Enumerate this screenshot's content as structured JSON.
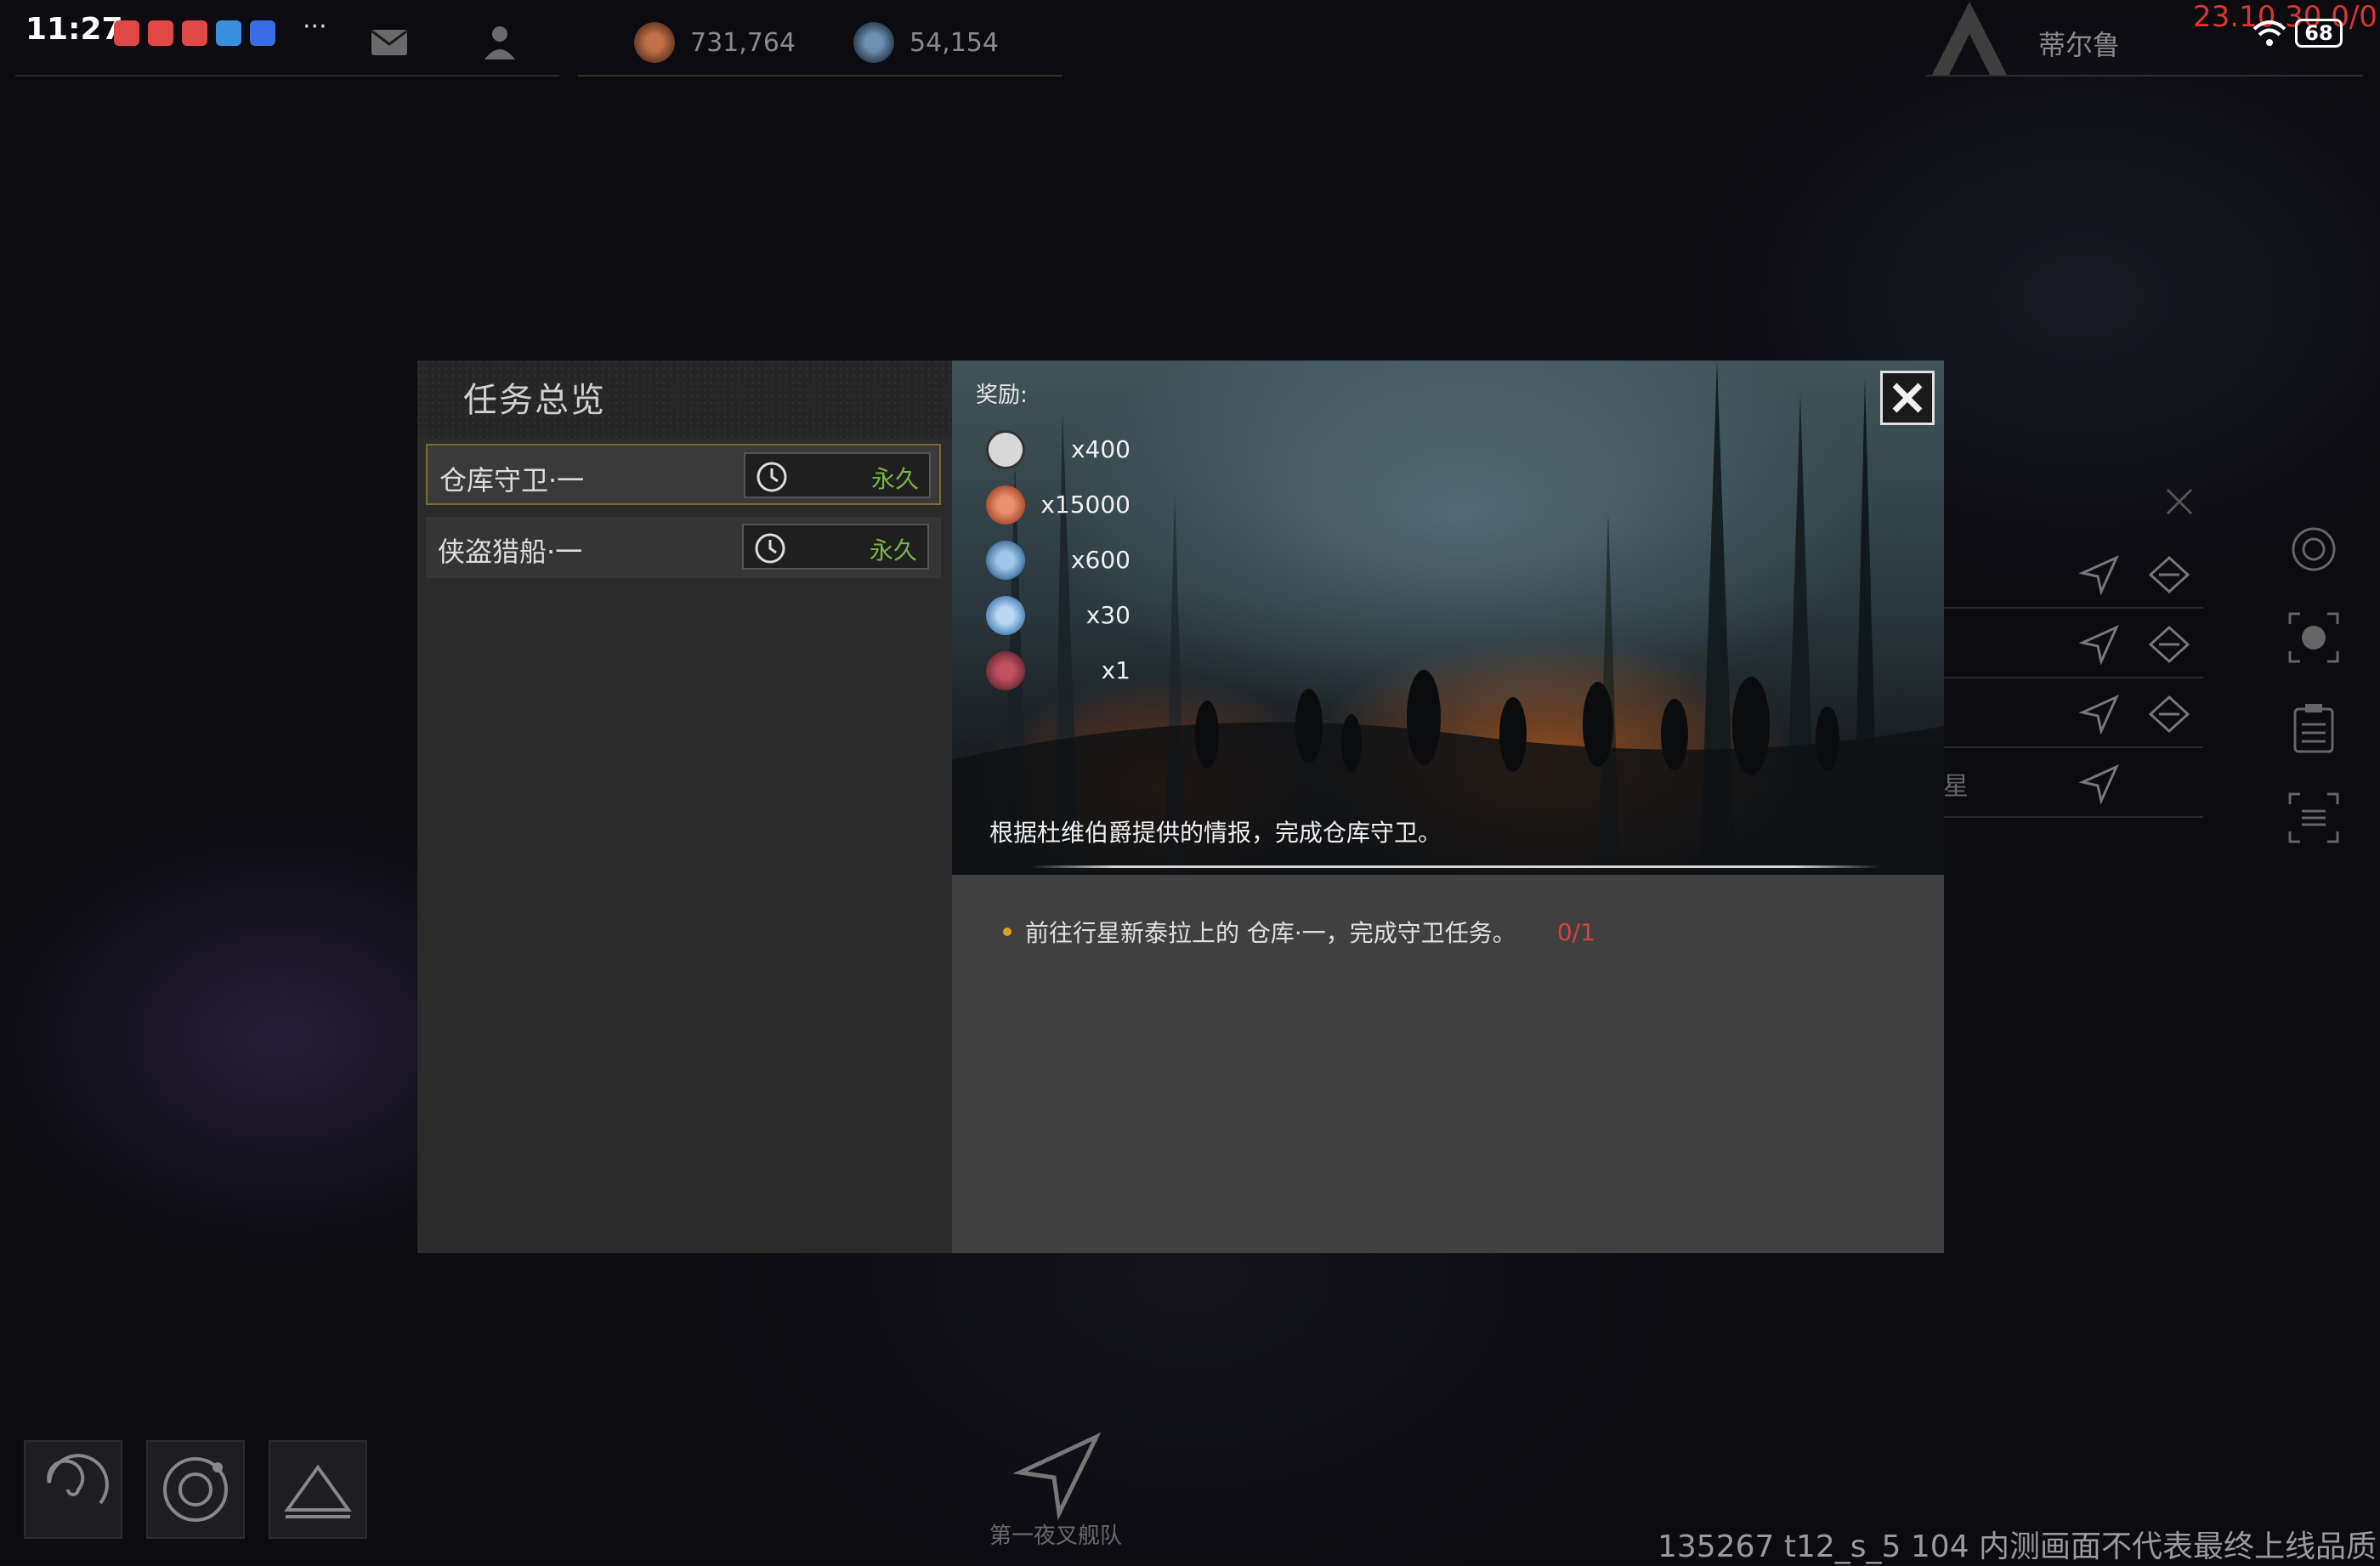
{
  "status_bar": {
    "time": "11:27",
    "more": "···",
    "version": "23.10.30 0/0",
    "battery": "68"
  },
  "resources": {
    "copper": "731,764",
    "crystal": "54,154"
  },
  "player": {
    "name": "蒂尔鲁"
  },
  "side_panel": {
    "row4_label": "星"
  },
  "dialog": {
    "title": "任务总览",
    "quests": [
      {
        "name": "仓库守卫·一",
        "duration": "永久"
      },
      {
        "name": "侠盗猎船·一",
        "duration": "永久"
      }
    ],
    "rewards_label": "奖励:",
    "rewards": [
      {
        "icon": "blueprint-icon",
        "qty": "x400"
      },
      {
        "icon": "copper-icon",
        "qty": "x15000"
      },
      {
        "icon": "crystal-icon",
        "qty": "x600"
      },
      {
        "icon": "deuterium-icon",
        "qty": "x30"
      },
      {
        "icon": "module-icon",
        "qty": "x1"
      }
    ],
    "description": "根据杜维伯爵提供的情报，完成仓库守卫。",
    "objective": "前往行星新泰拉上的 仓库·一，完成守卫任务。",
    "objective_progress": "0/1"
  },
  "bottom": {
    "fleet_label": "第一夜叉舰队",
    "build_info": "135267 t12_s_5 104 内测画面不代表最终上线品质"
  },
  "colors": {
    "accent_green": "#7ab548",
    "progress_red": "#d94040",
    "bullet_orange": "#e0a020",
    "version_red": "#dd3333"
  }
}
